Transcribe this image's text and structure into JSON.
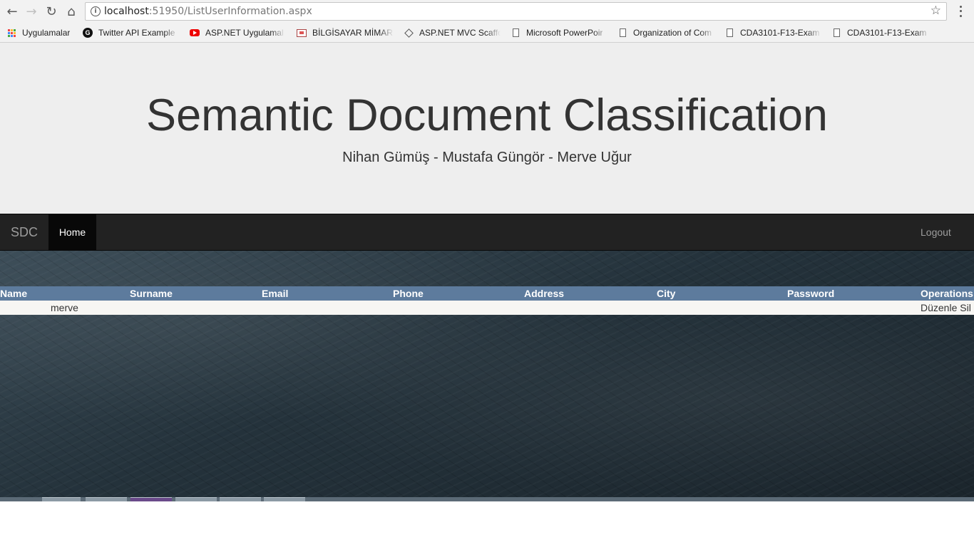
{
  "browser": {
    "url_host": "localhost",
    "url_path": ":51950/ListUserInformation.aspx",
    "bookmarks": [
      {
        "label": "Uygulamalar",
        "icon": "apps-grid-icon"
      },
      {
        "label": "Twitter API Example",
        "icon": "g-logo-icon"
      },
      {
        "label": "ASP.NET Uygulamal",
        "icon": "youtube-icon"
      },
      {
        "label": "BİLGİSAYAR MİMARİ",
        "icon": "presentation-icon"
      },
      {
        "label": "ASP.NET MVC Scaffo",
        "icon": "diamond-icon"
      },
      {
        "label": "Microsoft PowerPoir",
        "icon": "document-icon"
      },
      {
        "label": "Organization of Com",
        "icon": "document-icon"
      },
      {
        "label": "CDA3101-F13-Exam",
        "icon": "document-icon"
      },
      {
        "label": "CDA3101-F13-Exam",
        "icon": "document-icon"
      }
    ]
  },
  "header": {
    "title": "Semantic Document Classification",
    "subtitle": "Nihan Gümüş - Mustafa Güngör - Merve Uğur"
  },
  "navbar": {
    "brand": "SDC",
    "home": "Home",
    "logout": "Logout"
  },
  "table": {
    "headers": [
      "Name",
      "Surname",
      "Email",
      "Phone",
      "Address",
      "City",
      "Password",
      "Operations"
    ],
    "rows": [
      {
        "name": "merve",
        "surname": "",
        "email": "",
        "phone": "",
        "address": "",
        "city": "",
        "password": "",
        "edit": "Düzenle",
        "delete": "Sil"
      }
    ]
  },
  "colors": {
    "jumbotron_bg": "#eeeeee",
    "navbar_bg": "#222222",
    "grid_header_bg": "#5d7b9d",
    "grid_row_bg": "#f7f6f3"
  }
}
